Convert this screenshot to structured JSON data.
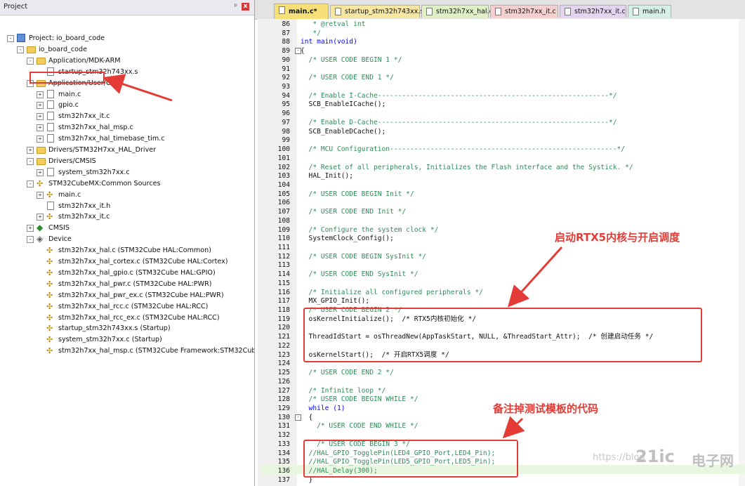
{
  "project_pane": {
    "title": "Project",
    "pin": "ᵖ",
    "close": "x",
    "tree": [
      {
        "label": "Project: io_board_code",
        "icon": "project-icon",
        "exp": "-",
        "indent": 0
      },
      {
        "label": "io_board_code",
        "icon": "target-folder-icon",
        "exp": "-",
        "indent": 1
      },
      {
        "label": "Application/MDK-ARM",
        "icon": "folder-icon",
        "exp": "-",
        "indent": 2
      },
      {
        "label": "startup_stm32h743xx.s",
        "icon": "file-icon",
        "exp": "",
        "indent": 3
      },
      {
        "label": "Application/User/Core",
        "icon": "folder-icon",
        "exp": "-",
        "indent": 2
      },
      {
        "label": "main.c",
        "icon": "file-icon",
        "exp": "+",
        "indent": 3
      },
      {
        "label": "gpio.c",
        "icon": "file-icon",
        "exp": "+",
        "indent": 3
      },
      {
        "label": "stm32h7xx_it.c",
        "icon": "file-icon",
        "exp": "+",
        "indent": 3
      },
      {
        "label": "stm32h7xx_hal_msp.c",
        "icon": "file-icon",
        "exp": "+",
        "indent": 3
      },
      {
        "label": "stm32h7xx_hal_timebase_tim.c",
        "icon": "file-icon",
        "exp": "+",
        "indent": 3
      },
      {
        "label": "Drivers/STM32H7xx_HAL_Driver",
        "icon": "folder-icon",
        "exp": "+",
        "indent": 2
      },
      {
        "label": "Drivers/CMSIS",
        "icon": "folder-icon",
        "exp": "-",
        "indent": 2
      },
      {
        "label": "system_stm32h7xx.c",
        "icon": "file-icon",
        "exp": "+",
        "indent": 3
      },
      {
        "label": "STM32CubeMX:Common Sources",
        "icon": "component-icon",
        "exp": "-",
        "indent": 2
      },
      {
        "label": "main.c",
        "icon": "component-icon",
        "exp": "+",
        "indent": 3
      },
      {
        "label": "stm32h7xx_it.h",
        "icon": "file-icon",
        "exp": "",
        "indent": 3
      },
      {
        "label": "stm32h7xx_it.c",
        "icon": "component-icon",
        "exp": "+",
        "indent": 3
      },
      {
        "label": "CMSIS",
        "icon": "gear-icon",
        "exp": "+",
        "indent": 2
      },
      {
        "label": "Device",
        "icon": "diamond-icon",
        "exp": "-",
        "indent": 2
      },
      {
        "label": "stm32h7xx_hal.c (STM32Cube HAL:Common)",
        "icon": "component-icon",
        "exp": "",
        "indent": 3
      },
      {
        "label": "stm32h7xx_hal_cortex.c (STM32Cube HAL:Cortex)",
        "icon": "component-icon",
        "exp": "",
        "indent": 3
      },
      {
        "label": "stm32h7xx_hal_gpio.c (STM32Cube HAL:GPIO)",
        "icon": "component-icon",
        "exp": "",
        "indent": 3
      },
      {
        "label": "stm32h7xx_hal_pwr.c (STM32Cube HAL:PWR)",
        "icon": "component-icon",
        "exp": "",
        "indent": 3
      },
      {
        "label": "stm32h7xx_hal_pwr_ex.c (STM32Cube HAL:PWR)",
        "icon": "component-icon",
        "exp": "",
        "indent": 3
      },
      {
        "label": "stm32h7xx_hal_rcc.c (STM32Cube HAL:RCC)",
        "icon": "component-icon",
        "exp": "",
        "indent": 3
      },
      {
        "label": "stm32h7xx_hal_rcc_ex.c (STM32Cube HAL:RCC)",
        "icon": "component-icon",
        "exp": "",
        "indent": 3
      },
      {
        "label": "startup_stm32h743xx.s (Startup)",
        "icon": "component-icon",
        "exp": "",
        "indent": 3
      },
      {
        "label": "system_stm32h7xx.c (Startup)",
        "icon": "component-icon",
        "exp": "",
        "indent": 3
      },
      {
        "label": "stm32h7xx_hal_msp.c (STM32Cube Framework:STM32CubeMX)",
        "icon": "component-icon",
        "exp": "",
        "indent": 3
      }
    ]
  },
  "tabs": [
    {
      "label": "main.c*",
      "active": true,
      "color": "#f7e07a"
    },
    {
      "label": "startup_stm32h743xx.s",
      "active": false,
      "color": "#f7e7a0"
    },
    {
      "label": "stm32h7xx_hal.c",
      "active": false,
      "color": "#dff0c6"
    },
    {
      "label": "stm32h7xx_it.c",
      "active": false,
      "color": "#f6cfcf"
    },
    {
      "label": "stm32h7xx_it.c",
      "active": false,
      "color": "#e4d4f0"
    },
    {
      "label": "main.h",
      "active": false,
      "color": "#d3efe6"
    }
  ],
  "code": [
    {
      "n": "86",
      "t": "   * @retval int",
      "fold": ""
    },
    {
      "n": "87",
      "t": "   */",
      "fold": ""
    },
    {
      "n": "88",
      "t": "int main(void)",
      "fold": ""
    },
    {
      "n": "89",
      "t": "{",
      "fold": "-"
    },
    {
      "n": "90",
      "t": "  /* USER CODE BEGIN 1 */",
      "fold": ""
    },
    {
      "n": "91",
      "t": "",
      "fold": ""
    },
    {
      "n": "92",
      "t": "  /* USER CODE END 1 */",
      "fold": ""
    },
    {
      "n": "93",
      "t": "",
      "fold": ""
    },
    {
      "n": "94",
      "t": "  /* Enable I-Cache---------------------------------------------------------*/",
      "fold": ""
    },
    {
      "n": "95",
      "t": "  SCB_EnableICache();",
      "fold": ""
    },
    {
      "n": "96",
      "t": "",
      "fold": ""
    },
    {
      "n": "97",
      "t": "  /* Enable D-Cache---------------------------------------------------------*/",
      "fold": ""
    },
    {
      "n": "98",
      "t": "  SCB_EnableDCache();",
      "fold": ""
    },
    {
      "n": "99",
      "t": "",
      "fold": ""
    },
    {
      "n": "100",
      "t": "  /* MCU Configuration--------------------------------------------------------*/",
      "fold": ""
    },
    {
      "n": "101",
      "t": "",
      "fold": ""
    },
    {
      "n": "102",
      "t": "  /* Reset of all peripherals, Initializes the Flash interface and the Systick. */",
      "fold": ""
    },
    {
      "n": "103",
      "t": "  HAL_Init();",
      "fold": ""
    },
    {
      "n": "104",
      "t": "",
      "fold": ""
    },
    {
      "n": "105",
      "t": "  /* USER CODE BEGIN Init */",
      "fold": ""
    },
    {
      "n": "106",
      "t": "",
      "fold": ""
    },
    {
      "n": "107",
      "t": "  /* USER CODE END Init */",
      "fold": ""
    },
    {
      "n": "108",
      "t": "",
      "fold": ""
    },
    {
      "n": "109",
      "t": "  /* Configure the system clock */",
      "fold": ""
    },
    {
      "n": "110",
      "t": "  SystemClock_Config();",
      "fold": ""
    },
    {
      "n": "111",
      "t": "",
      "fold": ""
    },
    {
      "n": "112",
      "t": "  /* USER CODE BEGIN SysInit */",
      "fold": ""
    },
    {
      "n": "113",
      "t": "",
      "fold": ""
    },
    {
      "n": "114",
      "t": "  /* USER CODE END SysInit */",
      "fold": ""
    },
    {
      "n": "115",
      "t": "",
      "fold": ""
    },
    {
      "n": "116",
      "t": "  /* Initialize all configured peripherals */",
      "fold": ""
    },
    {
      "n": "117",
      "t": "  MX_GPIO_Init();",
      "fold": ""
    },
    {
      "n": "118",
      "t": "  /* USER CODE BEGIN 2 */",
      "fold": ""
    },
    {
      "n": "119",
      "t": "  osKernelInitialize();  /* RTX5内核初始化 */",
      "fold": ""
    },
    {
      "n": "120",
      "t": "",
      "fold": ""
    },
    {
      "n": "121",
      "t": "  ThreadIdStart = osThreadNew(AppTaskStart, NULL, &ThreadStart_Attr);  /* 创建启动任务 */",
      "fold": ""
    },
    {
      "n": "122",
      "t": "",
      "fold": ""
    },
    {
      "n": "123",
      "t": "  osKernelStart();  /* 开启RTX5调度 */",
      "fold": ""
    },
    {
      "n": "124",
      "t": "",
      "fold": ""
    },
    {
      "n": "125",
      "t": "  /* USER CODE END 2 */",
      "fold": ""
    },
    {
      "n": "126",
      "t": "",
      "fold": ""
    },
    {
      "n": "127",
      "t": "  /* Infinite loop */",
      "fold": ""
    },
    {
      "n": "128",
      "t": "  /* USER CODE BEGIN WHILE */",
      "fold": ""
    },
    {
      "n": "129",
      "t": "  while (1)",
      "fold": ""
    },
    {
      "n": "130",
      "t": "  {",
      "fold": "-"
    },
    {
      "n": "131",
      "t": "    /* USER CODE END WHILE */",
      "fold": ""
    },
    {
      "n": "132",
      "t": "",
      "fold": ""
    },
    {
      "n": "133",
      "t": "    /* USER CODE BEGIN 3 */",
      "fold": ""
    },
    {
      "n": "134",
      "t": "  //HAL_GPIO_TogglePin(LED4_GPIO_Port,LED4_Pin);",
      "fold": ""
    },
    {
      "n": "135",
      "t": "  //HAL_GPIO_TogglePin(LED5_GPIO_Port,LED5_Pin);",
      "fold": ""
    },
    {
      "n": "136",
      "t": "  //HAL_Delay(300);",
      "fold": ""
    },
    {
      "n": "137",
      "t": "  }",
      "fold": ""
    }
  ],
  "annotations": {
    "start_kernel": "启动RTX5内核与开启调度",
    "comment_out": "备注掉测试模板的代码"
  },
  "watermark": {
    "url": "https://blog",
    "logo": "21ic",
    "sub": "电子网"
  },
  "colors": {
    "accent": "#e43b36",
    "comment": "#2e8b57",
    "keyword": "#0000ff"
  }
}
